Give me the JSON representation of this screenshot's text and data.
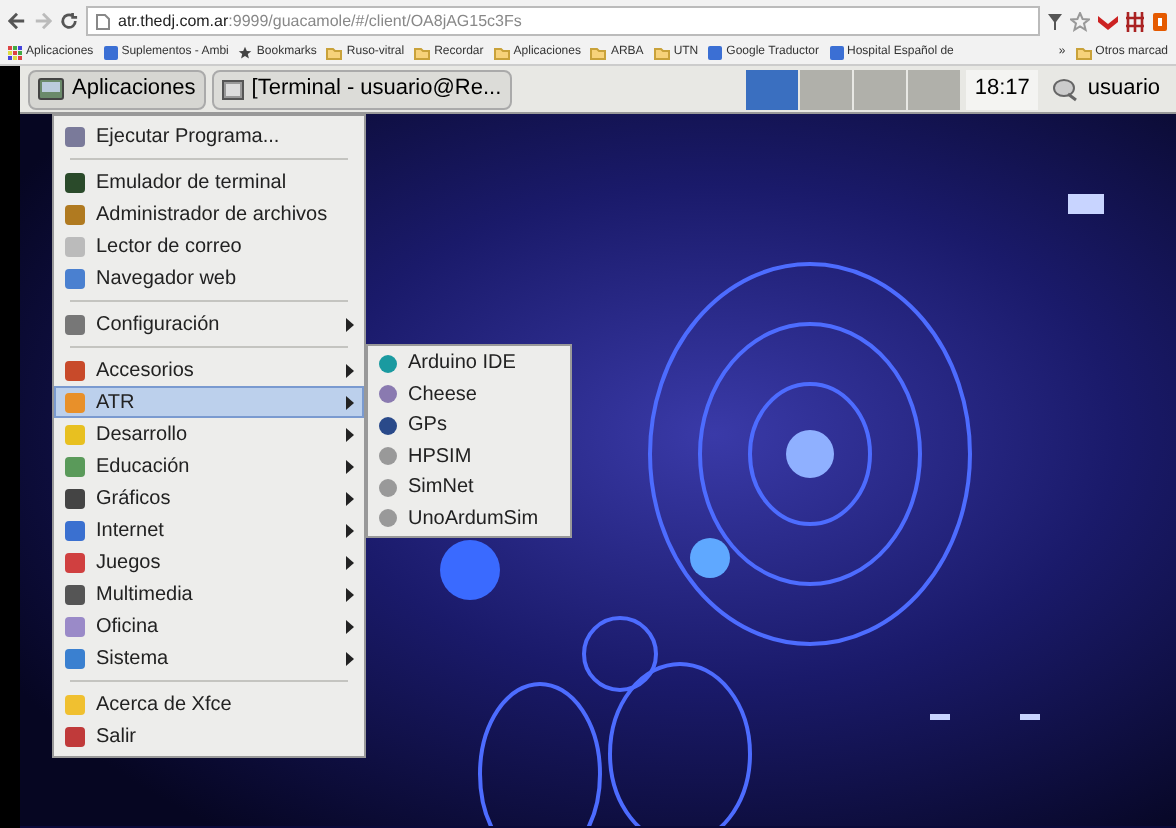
{
  "browser": {
    "url_host": "atr.thedj.com.ar",
    "url_path": ":9999/guacamole/#/client/OA8jAG15c3Fs",
    "bookmarks": [
      {
        "kind": "apps",
        "label": "Aplicaciones"
      },
      {
        "kind": "site",
        "label": "Suplementos - Ambi"
      },
      {
        "kind": "star",
        "label": "Bookmarks"
      },
      {
        "kind": "folder",
        "label": "Ruso-vitral"
      },
      {
        "kind": "folder",
        "label": "Recordar"
      },
      {
        "kind": "folder",
        "label": "Aplicaciones"
      },
      {
        "kind": "folder",
        "label": "ARBA"
      },
      {
        "kind": "folder",
        "label": "UTN"
      },
      {
        "kind": "site",
        "label": "Google Traductor"
      },
      {
        "kind": "site",
        "label": "Hospital Español de"
      }
    ],
    "more": "»",
    "other_bookmarks": "Otros marcad"
  },
  "panel": {
    "apps_button": "Aplicaciones",
    "task": "[Terminal - usuario@Re...",
    "workspaces": [
      {
        "selected": true
      },
      {
        "selected": false
      },
      {
        "selected": false
      },
      {
        "selected": false
      }
    ],
    "clock": "18:17",
    "user": "usuario"
  },
  "menu": [
    {
      "kind": "item",
      "label": "Ejecutar Programa...",
      "submenu": false,
      "selected": false
    },
    {
      "kind": "separator"
    },
    {
      "kind": "item",
      "label": "Emulador de terminal",
      "submenu": false,
      "selected": false
    },
    {
      "kind": "item",
      "label": "Administrador de archivos",
      "submenu": false,
      "selected": false
    },
    {
      "kind": "item",
      "label": "Lector de correo",
      "submenu": false,
      "selected": false
    },
    {
      "kind": "item",
      "label": "Navegador web",
      "submenu": false,
      "selected": false
    },
    {
      "kind": "separator"
    },
    {
      "kind": "item",
      "label": "Configuración",
      "submenu": true,
      "selected": false
    },
    {
      "kind": "separator"
    },
    {
      "kind": "item",
      "label": "Accesorios",
      "submenu": true,
      "selected": false
    },
    {
      "kind": "item",
      "label": "ATR",
      "submenu": true,
      "selected": true
    },
    {
      "kind": "item",
      "label": "Desarrollo",
      "submenu": true,
      "selected": false
    },
    {
      "kind": "item",
      "label": "Educación",
      "submenu": true,
      "selected": false
    },
    {
      "kind": "item",
      "label": "Gráficos",
      "submenu": true,
      "selected": false
    },
    {
      "kind": "item",
      "label": "Internet",
      "submenu": true,
      "selected": false
    },
    {
      "kind": "item",
      "label": "Juegos",
      "submenu": true,
      "selected": false
    },
    {
      "kind": "item",
      "label": "Multimedia",
      "submenu": true,
      "selected": false
    },
    {
      "kind": "item",
      "label": "Oficina",
      "submenu": true,
      "selected": false
    },
    {
      "kind": "item",
      "label": "Sistema",
      "submenu": true,
      "selected": false
    },
    {
      "kind": "separator"
    },
    {
      "kind": "item",
      "label": "Acerca de Xfce",
      "submenu": false,
      "selected": false
    },
    {
      "kind": "item",
      "label": "Salir",
      "submenu": false,
      "selected": false
    }
  ],
  "submenu": [
    {
      "label": "Arduino IDE"
    },
    {
      "label": "Cheese"
    },
    {
      "label": "GPs"
    },
    {
      "label": "HPSIM"
    },
    {
      "label": "SimNet"
    },
    {
      "label": "UnoArdumSim"
    }
  ]
}
